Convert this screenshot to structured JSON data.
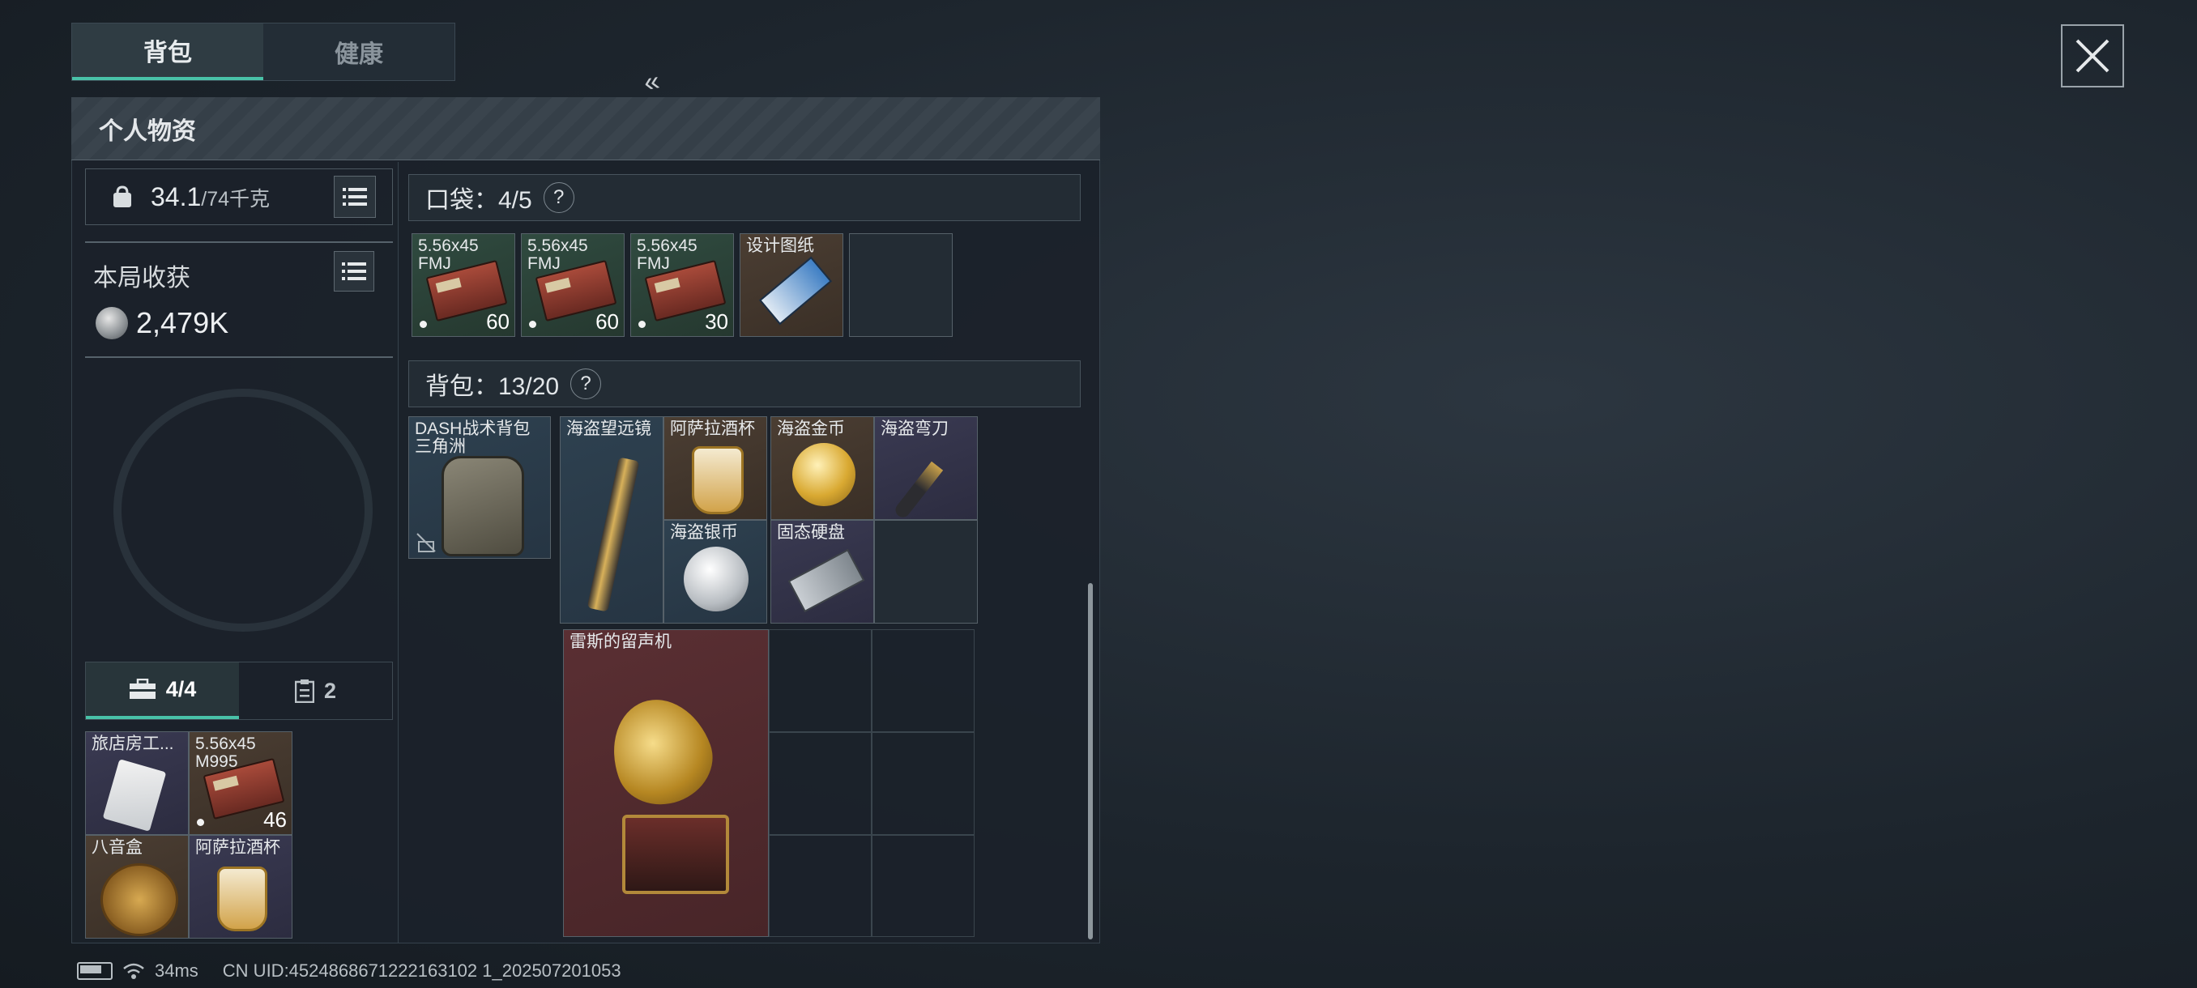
{
  "tabs": [
    {
      "label": "背包",
      "active": true
    },
    {
      "label": "健康",
      "active": false
    }
  ],
  "panel": {
    "title": "个人物资"
  },
  "weight": {
    "current": "34.1",
    "max": "/74千克"
  },
  "harvest": {
    "label": "本局收获",
    "value": "2,479K"
  },
  "pouch_tabs": [
    {
      "label": "4/4",
      "icon": "toolbox-icon",
      "active": true
    },
    {
      "label": "2",
      "icon": "clipboard-icon",
      "active": false
    }
  ],
  "pouch_items": [
    {
      "name": "旅店房工...",
      "count": ""
    },
    {
      "name": "5.56x45 M995",
      "count": "46"
    },
    {
      "name": "八音盒",
      "count": ""
    },
    {
      "name": "阿萨拉酒杯",
      "count": ""
    }
  ],
  "pockets": {
    "header": "口袋：4/5",
    "help": "?",
    "items": [
      {
        "name": "5.56x45 FMJ",
        "count": "60"
      },
      {
        "name": "5.56x45 FMJ",
        "count": "60"
      },
      {
        "name": "5.56x45 FMJ",
        "count": "30"
      },
      {
        "name": "设计图纸",
        "count": ""
      }
    ]
  },
  "backpack": {
    "header": "背包：13/20",
    "help": "?",
    "bag_name": "DASH战术背包三角洲",
    "items": [
      {
        "name": "海盗望远镜"
      },
      {
        "name": "阿萨拉酒杯"
      },
      {
        "name": "海盗银币"
      },
      {
        "name": "海盗金币"
      },
      {
        "name": "海盗弯刀"
      },
      {
        "name": "固态硬盘"
      },
      {
        "name": "雷斯的留声机"
      }
    ]
  },
  "status": {
    "ping": "34ms",
    "uid": "CN UID:4524868671222163102 1_202507201053"
  },
  "colors": {
    "accent": "#49c2a8",
    "legendary": "#5a2f33",
    "epic": "#3a3a52",
    "rare": "#2e4150"
  }
}
